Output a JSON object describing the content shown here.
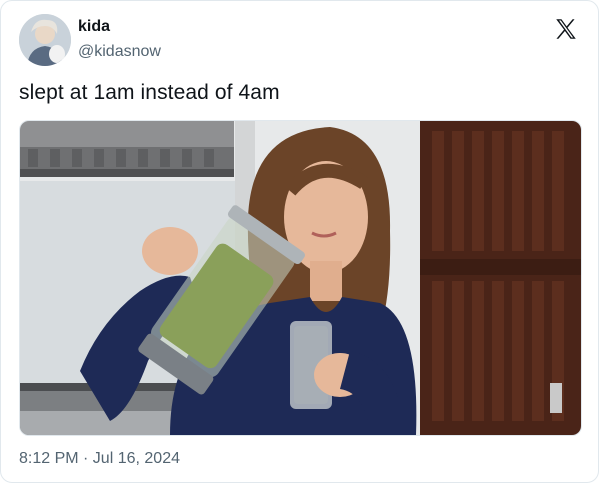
{
  "tweet": {
    "author_name": "kida",
    "author_handle": "@kidasnow",
    "text": "slept at 1am instead of 4am",
    "timestamp": "8:12 PM · Jul 16, 2024"
  },
  "icons": {
    "platform_logo": "x-logo-icon",
    "avatar": "avatar"
  },
  "colors": {
    "text_primary": "#0f1419",
    "text_secondary": "#536471",
    "border": "#e1e8ed"
  }
}
